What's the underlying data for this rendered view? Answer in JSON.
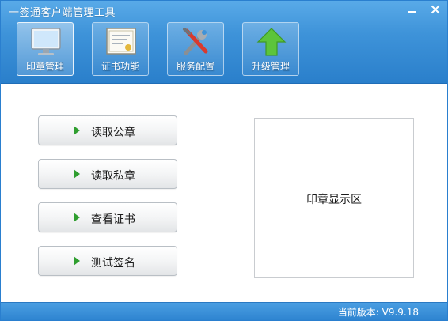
{
  "window": {
    "title": "一签通客户端管理工具",
    "minimize_icon": "minimize-icon",
    "close_icon": "close-icon"
  },
  "toolbar": [
    {
      "id": "seal",
      "label": "印章管理",
      "icon": "monitor-icon",
      "active": true
    },
    {
      "id": "cert",
      "label": "证书功能",
      "icon": "certificate-icon",
      "active": false
    },
    {
      "id": "service",
      "label": "服务配置",
      "icon": "tools-icon",
      "active": false
    },
    {
      "id": "upgrade",
      "label": "升级管理",
      "icon": "upgrade-arrow-icon",
      "active": false
    }
  ],
  "actions": [
    {
      "label": "读取公章"
    },
    {
      "label": "读取私章"
    },
    {
      "label": "查看证书"
    },
    {
      "label": "测试签名"
    }
  ],
  "seal_area": {
    "label": "印章显示区"
  },
  "status": {
    "version": "当前版本: V9.9.18"
  },
  "colors": {
    "header": "#3e93d9",
    "accent_arrow": "#2f9e2f",
    "upgrade_arrow": "#5cc43c"
  }
}
